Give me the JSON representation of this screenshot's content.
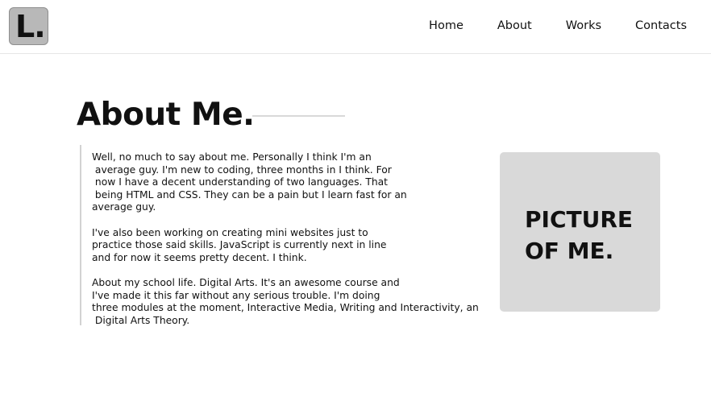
{
  "header": {
    "logo_text": "L.",
    "nav": {
      "home": "Home",
      "about": "About",
      "works": "Works",
      "contacts": "Contacts"
    }
  },
  "main": {
    "title": "About Me.",
    "paragraphs": [
      "Well, no much to say about me. Personally I think I'm an\n average guy. I'm new to coding, three months in I think. For\n now I have a decent understanding of two languages. That\n being HTML and CSS. They can be a pain but I learn fast for an\naverage guy.",
      "I've also been working on creating mini websites just to\npractice those said skills. JavaScript is currently next in line\nand for now it seems pretty decent. I think.",
      "About my school life. Digital Arts. It's an awesome course and\nI've made it this far without any serious trouble. I'm doing\nthree modules at the moment, Interactive Media, Writing and Interactivity, an\n Digital Arts Theory."
    ],
    "photo_placeholder": "PICTURE\nOF ME."
  },
  "colors": {
    "background": "#ffffff",
    "logo_bg": "#b8b8b8",
    "photo_bg": "#d9d9d9",
    "rule": "#d9d9d9",
    "text": "#111111"
  }
}
